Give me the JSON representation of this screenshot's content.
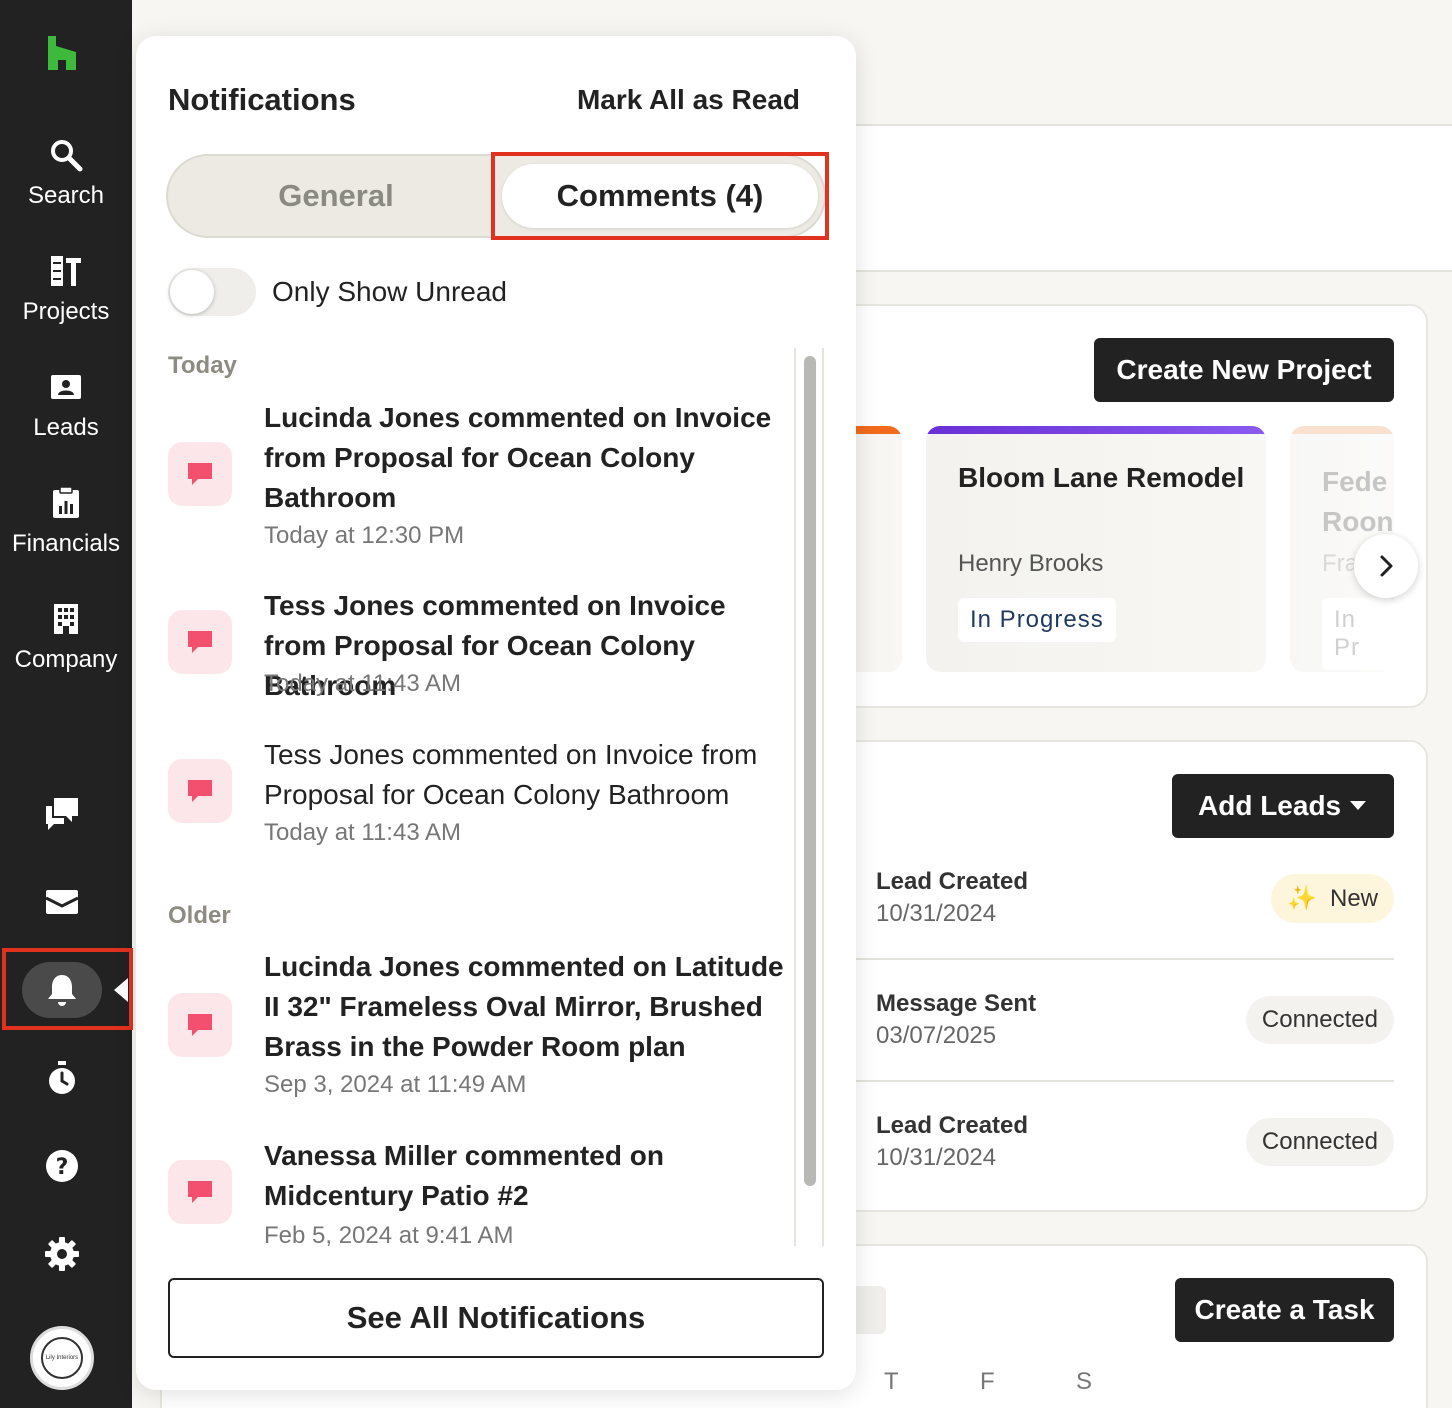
{
  "sidebar": {
    "items": [
      {
        "label": "Search",
        "icon": "search-icon"
      },
      {
        "label": "Projects",
        "icon": "projects-icon"
      },
      {
        "label": "Leads",
        "icon": "leads-icon"
      },
      {
        "label": "Financials",
        "icon": "financials-icon"
      },
      {
        "label": "Company",
        "icon": "company-icon"
      }
    ],
    "avatar_text": "Lily Interiors"
  },
  "notifications": {
    "title": "Notifications",
    "mark_all": "Mark All as Read",
    "tabs": {
      "general": "General",
      "comments": "Comments (4)"
    },
    "toggle_label": "Only Show Unread",
    "sections": {
      "today": "Today",
      "older": "Older"
    },
    "items": [
      {
        "text": "Lucinda Jones commented on Invoice from Proposal for Ocean Colony Bathroom",
        "time": "Today at 12:30 PM",
        "unread": true
      },
      {
        "text": "Tess Jones commented on Invoice from Proposal for Ocean Colony Bathroom",
        "time": "Today at 11:43 AM",
        "unread": true
      },
      {
        "text": "Tess Jones commented on Invoice from Proposal for Ocean Colony Bathroom",
        "time": "Today at 11:43 AM",
        "unread": false
      },
      {
        "text": "Lucinda Jones commented on Latitude II 32\" Frameless Oval Mirror, Brushed Brass in the Powder Room plan",
        "time": "Sep 3, 2024 at 11:49 AM",
        "unread": true
      },
      {
        "text": "Vanessa Miller commented on Midcentury Patio #2",
        "time": "Feb 5, 2024 at 9:41 AM",
        "unread": true
      }
    ],
    "see_all": "See All Notifications"
  },
  "projects": {
    "create_button": "Create New Project",
    "cards": [
      {
        "title": "Bloom Lane Remodel",
        "owner": "Henry Brooks",
        "status": "In Progress"
      },
      {
        "title": "Fede Roon",
        "owner": "Fra",
        "status": "In Pr"
      }
    ]
  },
  "leads": {
    "add_button": "Add Leads",
    "rows": [
      {
        "type": "Lead Created",
        "date": "10/31/2024",
        "badge": "New",
        "badge_icon": "sparkle-icon"
      },
      {
        "type": "Message Sent",
        "date": "03/07/2025",
        "badge": "Connected"
      },
      {
        "type": "Lead Created",
        "date": "10/31/2024",
        "badge": "Connected"
      }
    ]
  },
  "tasks": {
    "create_button": "Create a Task",
    "days": [
      "T",
      "F",
      "S"
    ]
  },
  "colors": {
    "sidebar": "#222222",
    "accent_green": "#3dba3b",
    "highlight_red": "#e0321e",
    "chat_pink": "#f2506e"
  }
}
